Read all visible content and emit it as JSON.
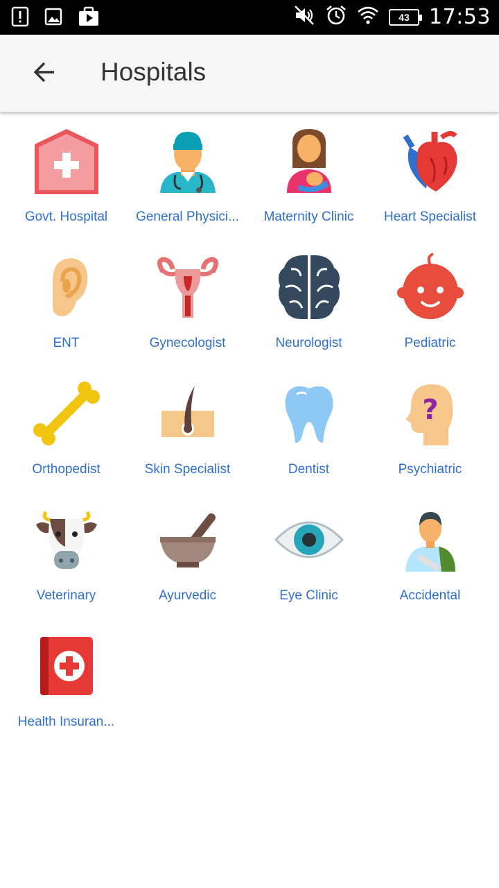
{
  "status_bar": {
    "time": "17:53",
    "battery_level": "43",
    "left_icons": [
      "alert-icon",
      "image-icon",
      "play-store-icon"
    ],
    "right_icons": [
      "mute-icon",
      "alarm-icon",
      "wifi-icon",
      "battery-icon"
    ]
  },
  "app_bar": {
    "title": "Hospitals",
    "back_icon": "arrow-back-icon"
  },
  "categories": [
    {
      "label": "Govt. Hospital",
      "icon": "hospital-icon"
    },
    {
      "label": "General Physici...",
      "icon": "doctor-icon"
    },
    {
      "label": "Maternity Clinic",
      "icon": "mother-baby-icon"
    },
    {
      "label": "Heart Specialist",
      "icon": "heart-organ-icon"
    },
    {
      "label": "ENT",
      "icon": "ear-icon"
    },
    {
      "label": "Gynecologist",
      "icon": "uterus-icon"
    },
    {
      "label": "Neurologist",
      "icon": "brain-icon"
    },
    {
      "label": "Pediatric",
      "icon": "baby-face-icon"
    },
    {
      "label": "Orthopedist",
      "icon": "bone-icon"
    },
    {
      "label": "Skin Specialist",
      "icon": "skin-hair-icon"
    },
    {
      "label": "Dentist",
      "icon": "tooth-icon"
    },
    {
      "label": "Psychiatric",
      "icon": "head-question-icon"
    },
    {
      "label": "Veterinary",
      "icon": "cow-icon"
    },
    {
      "label": "Ayurvedic",
      "icon": "mortar-pestle-icon"
    },
    {
      "label": "Eye Clinic",
      "icon": "eye-icon"
    },
    {
      "label": "Accidental",
      "icon": "injured-person-icon"
    },
    {
      "label": "Health Insuran...",
      "icon": "medical-book-icon"
    }
  ],
  "colors": {
    "label": "#2f6fd0",
    "appbar_bg": "#f6f6f6",
    "title": "#333333"
  }
}
